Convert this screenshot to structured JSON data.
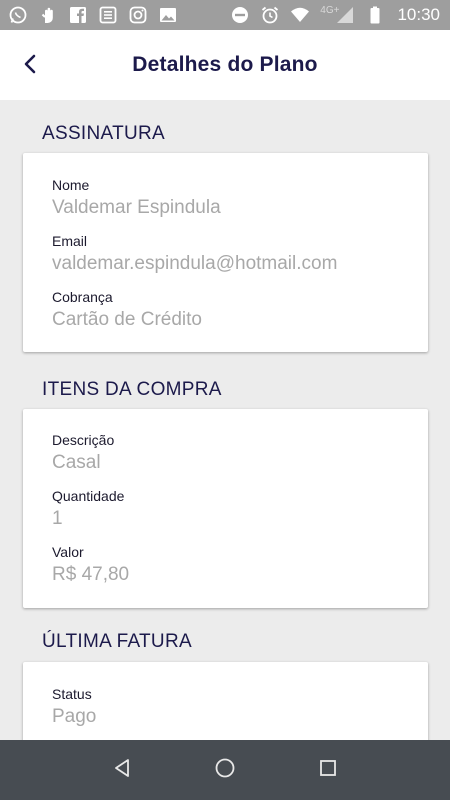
{
  "status_bar": {
    "time": "10:30",
    "network": "4G+",
    "icons_left": [
      "whatsapp-icon",
      "hand-icon",
      "facebook-icon",
      "news-icon",
      "instagram-icon",
      "image-icon"
    ],
    "icons_right": [
      "do-not-disturb-icon",
      "alarm-icon",
      "wifi-icon",
      "signal-icon",
      "battery-icon"
    ]
  },
  "header": {
    "title": "Detalhes do Plano",
    "back_icon": "chevron-left-icon"
  },
  "sections": {
    "assinatura": {
      "title": "ASSINATURA",
      "fields": [
        {
          "label": "Nome",
          "value": "Valdemar Espindula"
        },
        {
          "label": "Email",
          "value": "valdemar.espindula@hotmail.com"
        },
        {
          "label": "Cobrança",
          "value": "Cartão de Crédito"
        }
      ]
    },
    "itens": {
      "title": "ITENS DA COMPRA",
      "fields": [
        {
          "label": "Descrição",
          "value": "Casal"
        },
        {
          "label": "Quantidade",
          "value": "1"
        },
        {
          "label": "Valor",
          "value": "R$ 47,80"
        }
      ]
    },
    "fatura": {
      "title": "ÚLTIMA FATURA",
      "fields": [
        {
          "label": "Status",
          "value": "Pago"
        }
      ]
    }
  },
  "nav_bar": {
    "icons": [
      "back-triangle-icon",
      "home-circle-icon",
      "recents-square-icon"
    ]
  },
  "colors": {
    "title": "#1c1a4b",
    "value": "#a8a8a8",
    "background": "#ececec",
    "status_bar": "#9e9e9e",
    "nav_bar": "#474c52"
  }
}
